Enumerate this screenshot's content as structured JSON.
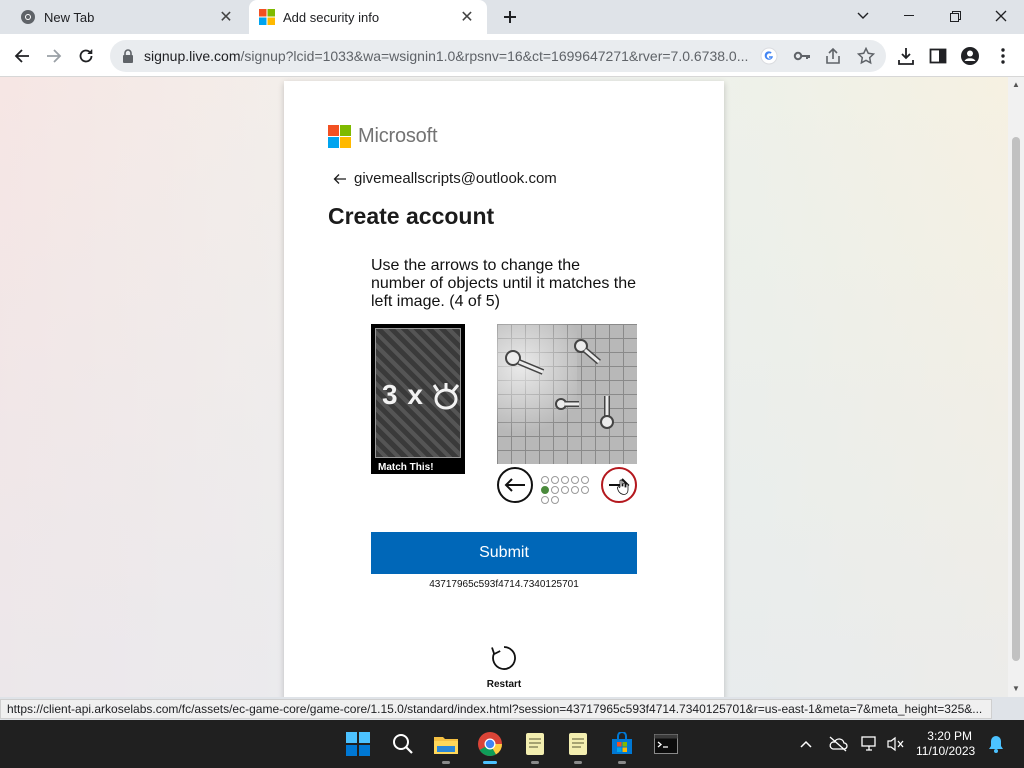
{
  "browser": {
    "tabs": [
      {
        "title": "New Tab",
        "icon": "chrome-icon",
        "active": false
      },
      {
        "title": "Add security info",
        "icon": "microsoft-icon",
        "active": true
      }
    ],
    "url_host": "signup.live.com",
    "url_rest": "/signup?lcid=1033&wa=wsignin1.0&rpsnv=16&ct=1699647271&rver=7.0.6738.0...",
    "status_url": "https://client-api.arkoselabs.com/fc/assets/ec-game-core/game-core/1.15.0/standard/index.html?session=43717965c593f4714.7340125701&r=us-east-1&meta=7&meta_height=325&...",
    "status_url_tail": "s"
  },
  "page": {
    "brand": "Microsoft",
    "email": "givemeallscripts@outlook.com",
    "title": "Create account",
    "challenge": {
      "instructions": "Use the arrows to change the number of objects until it matches the left image. (4 of 5)",
      "reference_text": "3 x",
      "reference_caption": "Match This!",
      "dots_total": 15,
      "dots_active_index": 10
    },
    "submit_label": "Submit",
    "session_id": "43717965c593f4714.7340125701",
    "restart_label": "Restart"
  },
  "taskbar": {
    "apps": [
      "windows-start-icon",
      "search-icon",
      "file-explorer-icon",
      "chrome-icon",
      "notepad-icon",
      "notepad-icon",
      "microsoft-store-icon",
      "terminal-icon"
    ],
    "time": "3:20 PM",
    "date": "11/10/2023"
  },
  "colors": {
    "accent": "#0067b8",
    "ms_red": "#f25022",
    "ms_green": "#7fba00",
    "ms_blue": "#00a4ef",
    "ms_yellow": "#ffb900"
  }
}
